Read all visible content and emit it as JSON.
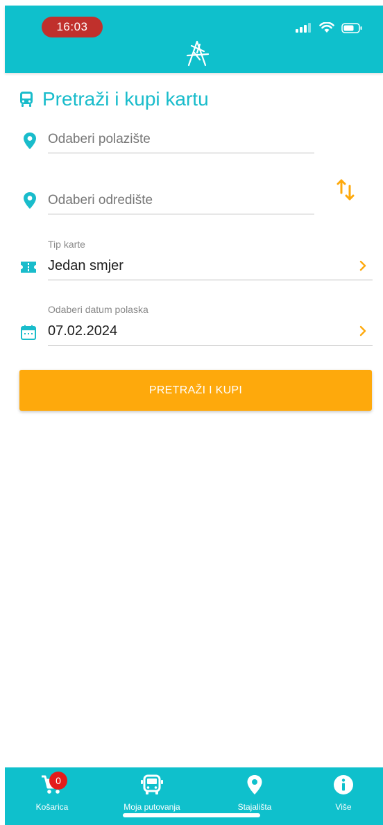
{
  "status_bar": {
    "time": "16:03"
  },
  "header": {
    "logo_icon": "stylized-traveler-logo"
  },
  "page": {
    "title": "Pretraži i kupi kartu",
    "title_icon": "bus-icon"
  },
  "form": {
    "origin_placeholder": "Odaberi polazište",
    "destination_placeholder": "Odaberi odredište",
    "ticket_type": {
      "label": "Tip karte",
      "value": "Jedan smjer"
    },
    "departure_date": {
      "label": "Odaberi datum polaska",
      "value": "07.02.2024"
    },
    "submit_label": "PRETRAŽI I KUPI"
  },
  "bottom_nav": {
    "items": [
      {
        "label": "Košarica",
        "icon": "cart-icon",
        "badge": "0"
      },
      {
        "label": "Moja putovanja",
        "icon": "bus-icon"
      },
      {
        "label": "Stajališta",
        "icon": "location-pin-icon"
      },
      {
        "label": "Više",
        "icon": "info-icon"
      }
    ]
  },
  "colors": {
    "primary": "#0fc0cc",
    "accent": "#fea90c",
    "badge": "#e41b1b",
    "time_pill": "#c0302c"
  }
}
